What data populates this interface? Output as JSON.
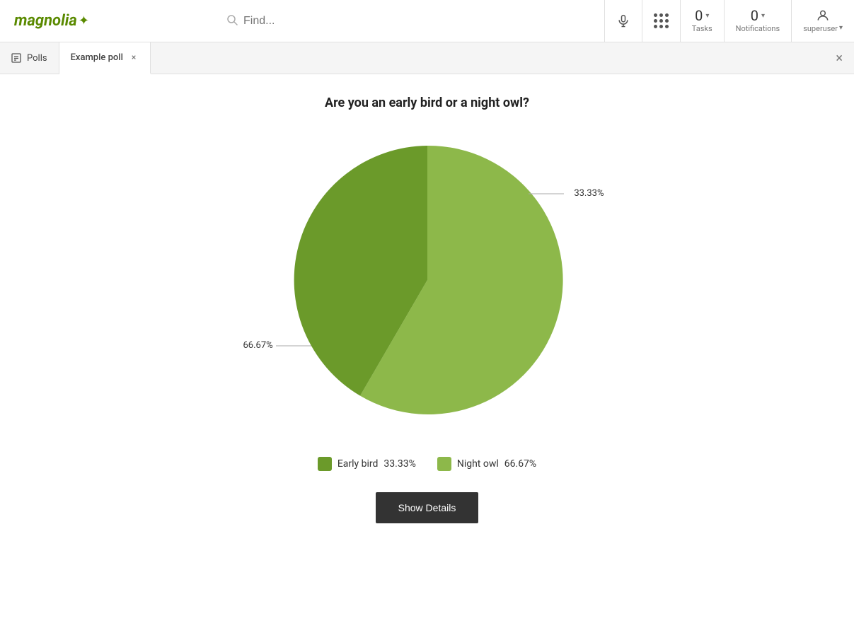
{
  "logo": {
    "text": "magnolia",
    "star": "✦"
  },
  "search": {
    "placeholder": "Find..."
  },
  "topbar": {
    "tasks_count": "0",
    "tasks_label": "Tasks",
    "notifications_count": "0",
    "notifications_label": "Notifications",
    "user_name": "superuser"
  },
  "tabs": {
    "polls_label": "Polls",
    "active_tab_label": "Example poll",
    "close_label": "×",
    "close_all_label": "×"
  },
  "poll": {
    "title": "Are you an early bird or a night owl?",
    "slices": [
      {
        "label": "Early bird",
        "percent": 33.33,
        "color": "#6b9a2a",
        "display": "33.33%"
      },
      {
        "label": "Night owl",
        "percent": 66.67,
        "color": "#8db84a",
        "display": "66.67%"
      }
    ],
    "label_early": "33.33%",
    "label_night": "66.67%",
    "legend": [
      {
        "label": "Early bird",
        "percent": "33.33%",
        "color": "#6b9a2a"
      },
      {
        "label": "Night owl",
        "percent": "66.67%",
        "color": "#8db84a"
      }
    ],
    "button_label": "Show Details"
  }
}
